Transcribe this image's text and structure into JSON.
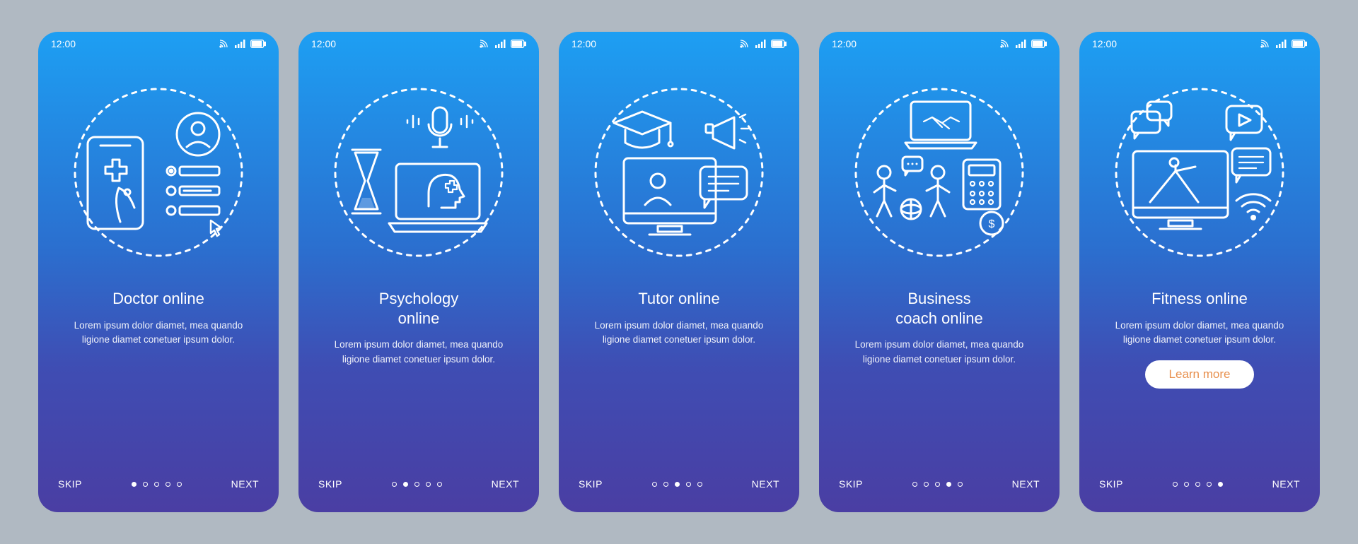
{
  "status": {
    "time": "12:00"
  },
  "common": {
    "skip": "SKIP",
    "next": "NEXT",
    "desc": "Lorem ipsum dolor diamet, mea quando ligione diamet conetuer ipsum dolor."
  },
  "cta": {
    "label": "Learn more"
  },
  "screens": [
    {
      "title": "Doctor online",
      "activeDot": 0
    },
    {
      "title": "Psychology\nonline",
      "activeDot": 1
    },
    {
      "title": "Tutor online",
      "activeDot": 2
    },
    {
      "title": "Business\ncoach online",
      "activeDot": 3
    },
    {
      "title": "Fitness online",
      "activeDot": 4,
      "cta": true
    }
  ]
}
